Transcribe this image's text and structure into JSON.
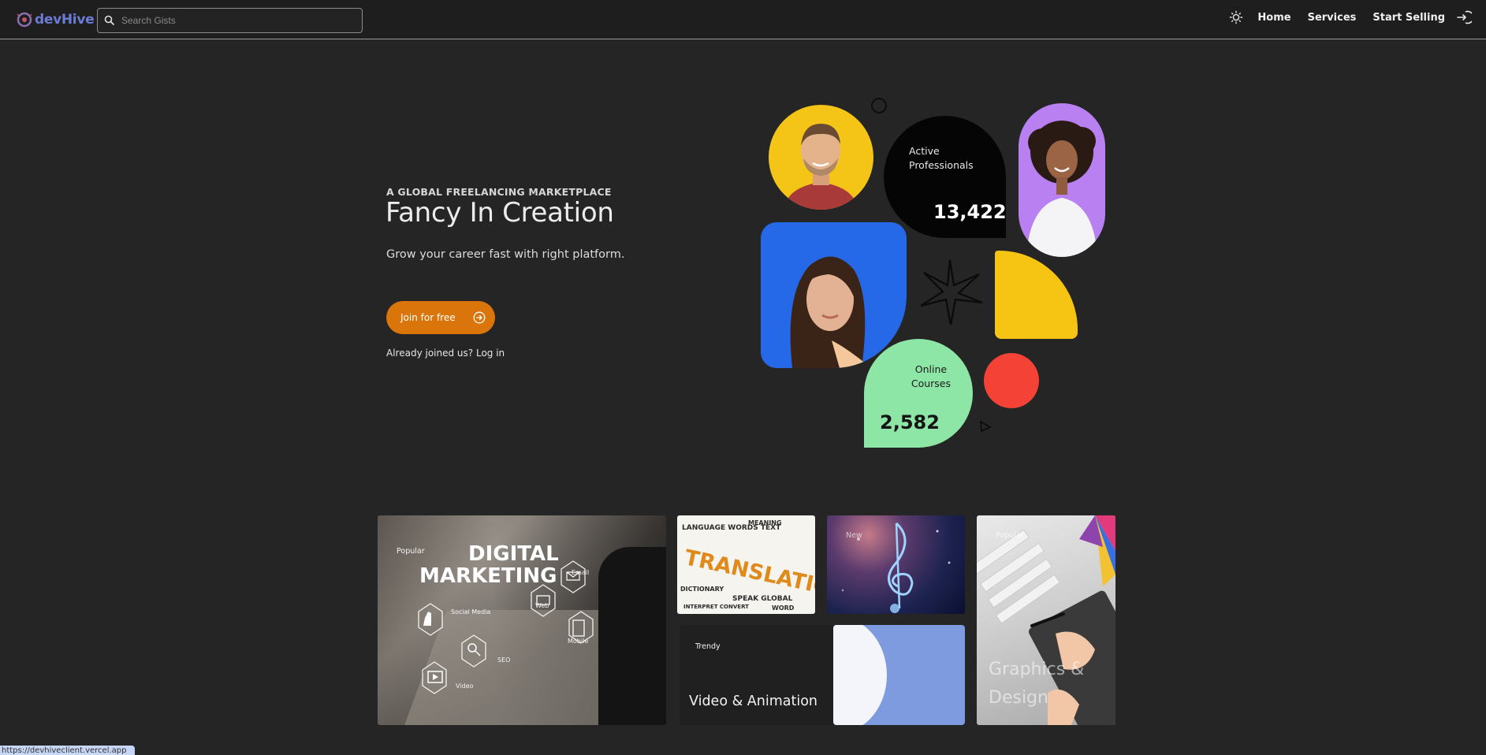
{
  "nav": {
    "logo_text": "devHive",
    "search_placeholder": "Search Gists",
    "links": [
      "Home",
      "Services",
      "Start Selling"
    ]
  },
  "hero": {
    "eyebrow": "A GLOBAL FREELANCING MARKETPLACE",
    "title": "Fancy In Creation",
    "subtitle": "Grow your career fast with right platform.",
    "join_label": "Join for free",
    "login_prefix": "Already joined us?",
    "login_link": "Log in"
  },
  "stats": {
    "active_label_1": "Active",
    "active_label_2": "Professionals",
    "active_value": "13,422",
    "courses_label_1": "Online",
    "courses_label_2": "Courses",
    "courses_value": "2,582"
  },
  "categories": {
    "digital_marketing": {
      "tag": "Popular",
      "title_1": "DIGITAL",
      "title_2": "MARKETING",
      "hex_labels": [
        "Email",
        "Web",
        "Social Media",
        "SEO",
        "Mobile",
        "Video"
      ]
    },
    "translation": {
      "title": "TRANSLATION"
    },
    "music": {
      "tag": "New"
    },
    "graphics": {
      "tag": "Popular",
      "title": "Graphics & Design"
    },
    "video": {
      "tag": "Trendy",
      "title": "Video & Animation"
    }
  },
  "status_bar": {
    "url": "https://devhiveclient.vercel.app"
  },
  "colors": {
    "accent_orange": "#d9750a",
    "brand_blue": "#6b7bd6",
    "stat_black": "#050505",
    "stat_green": "#8ee6a6",
    "shape_yellow": "#f6c514",
    "shape_red": "#f44336",
    "photo_blue": "#2568e8",
    "photo_purple": "#b880f0"
  }
}
